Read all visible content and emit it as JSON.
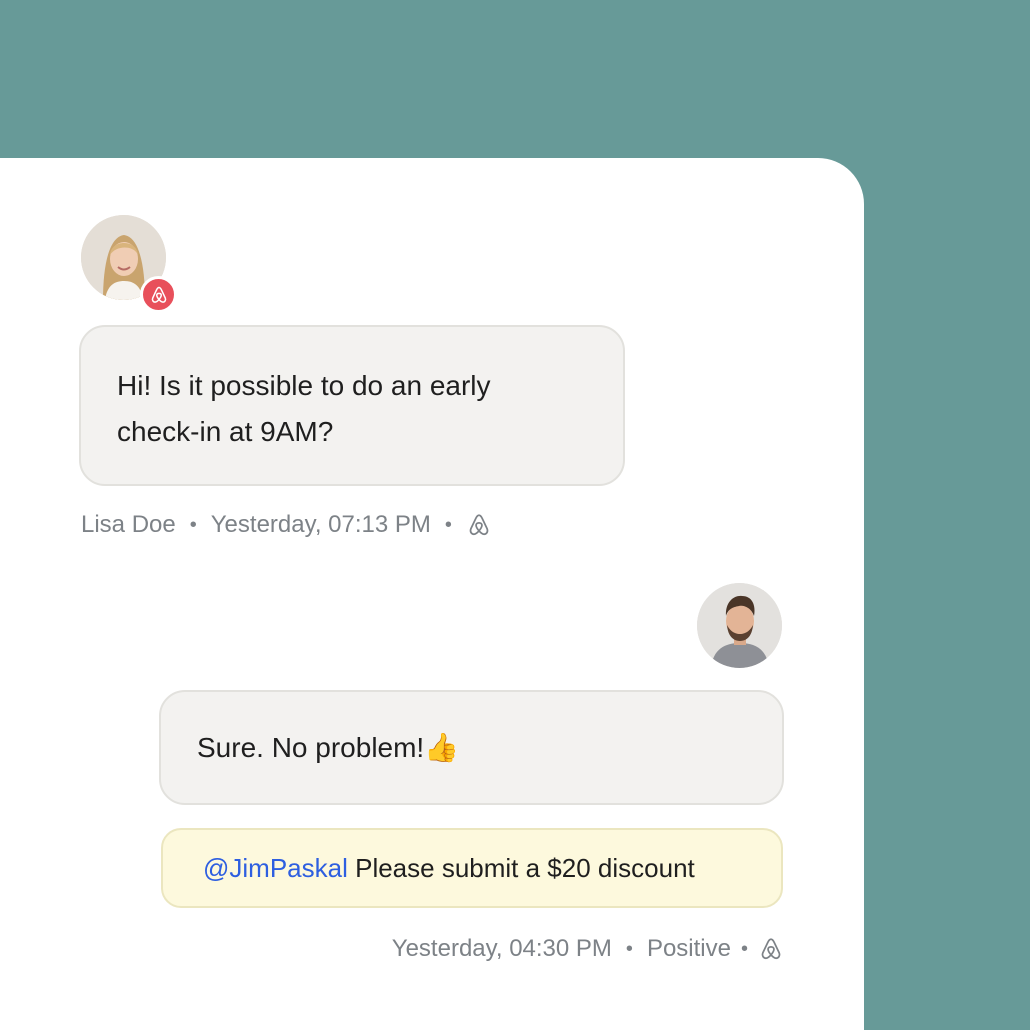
{
  "colors": {
    "background": "#679a98",
    "card": "#ffffff",
    "bubble": "#f3f2f0",
    "note": "#fdf9dd",
    "mention": "#2e5fe0",
    "badge": "#e8505b",
    "meta_text": "#7d8287"
  },
  "guest_message": {
    "text_line_1": "Hi! Is it possible to do an early",
    "text_line_2": "check-in at 9AM?",
    "sender": "Lisa Doe",
    "separator": "•",
    "timestamp": "Yesterday, 07:13 PM",
    "avatar": "female-guest-avatar",
    "channel_icon": "airbnb-icon"
  },
  "host_message": {
    "text": "Sure. No problem!",
    "emoji": "👍",
    "avatar": "male-host-avatar"
  },
  "internal_note": {
    "mention": "@JimPaskal",
    "text": " Please submit a $20 discount"
  },
  "host_meta": {
    "timestamp": "Yesterday, 04:30 PM",
    "separator": "•",
    "sentiment": "Positive",
    "channel_icon": "airbnb-icon"
  }
}
